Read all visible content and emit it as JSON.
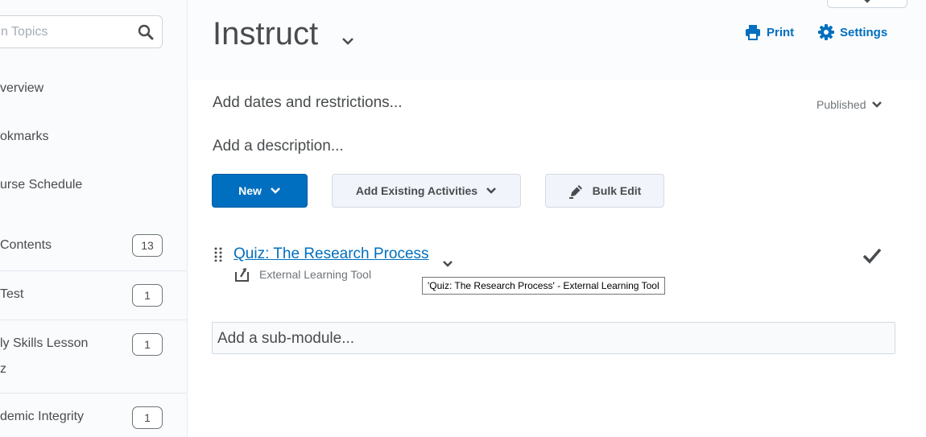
{
  "sidebar": {
    "search_placeholder": "n Topics",
    "nav": [
      {
        "label": "verview"
      },
      {
        "label": "okmarks"
      },
      {
        "label": "urse Schedule"
      }
    ],
    "toc": [
      {
        "label": " Contents",
        "count": "13"
      },
      {
        "label": "Test",
        "count": "1"
      },
      {
        "label": "ly Skills Lesson",
        "label2": "z",
        "count": "1"
      },
      {
        "label": "demic Integrity",
        "count": "1"
      }
    ]
  },
  "header": {
    "module_title": "Instruct",
    "print_label": "Print",
    "settings_label": "Settings"
  },
  "module": {
    "dates_link": "Add dates and restrictions...",
    "description_link": "Add a description...",
    "status": "Published"
  },
  "toolbar": {
    "new_label": "New",
    "add_existing_label": "Add Existing Activities",
    "bulk_edit_label": "Bulk Edit"
  },
  "activity": {
    "title": "Quiz: The Research Process",
    "type": "External Learning Tool",
    "tooltip": "'Quiz: The Research Process' - External Learning Tool"
  },
  "submodule_placeholder": "Add a sub-module...",
  "colors": {
    "accent": "#006fbf",
    "text": "#494c4e",
    "muted": "#6e7477"
  }
}
